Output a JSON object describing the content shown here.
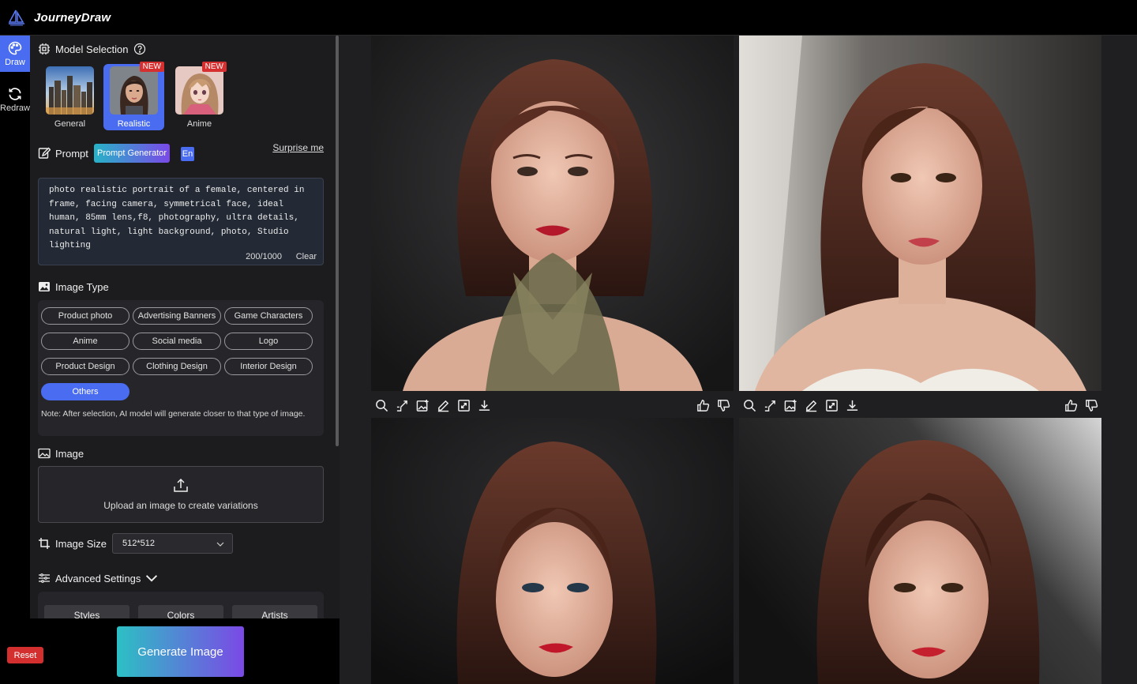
{
  "app": {
    "title": "JourneyDraw"
  },
  "rail": [
    {
      "label": "Draw",
      "icon": "palette-icon",
      "active": true
    },
    {
      "label": "Redraw",
      "icon": "refresh-icon",
      "active": false
    }
  ],
  "model_selection": {
    "title": "Model Selection",
    "models": [
      {
        "label": "General",
        "new": false,
        "active": false
      },
      {
        "label": "Realistic",
        "new": true,
        "badge": "NEW",
        "active": true
      },
      {
        "label": "Anime",
        "new": true,
        "badge": "NEW",
        "active": false
      }
    ]
  },
  "prompt": {
    "title": "Prompt",
    "generator_label": "Prompt Generator",
    "lang_label": "En",
    "surprise_label": "Surprise me",
    "text": "photo realistic portrait of a female, centered in frame, facing camera, symmetrical face, ideal human, 85mm lens,f8, photography, ultra details, natural light, light background, photo, Studio lighting",
    "count": "200/1000",
    "clear_label": "Clear"
  },
  "image_type": {
    "title": "Image Type",
    "options": [
      {
        "label": "Product photo",
        "active": false
      },
      {
        "label": "Advertising Banners",
        "active": false
      },
      {
        "label": "Game Characters",
        "active": false
      },
      {
        "label": "Anime",
        "active": false
      },
      {
        "label": "Social media",
        "active": false
      },
      {
        "label": "Logo",
        "active": false
      },
      {
        "label": "Product Design",
        "active": false
      },
      {
        "label": "Clothing Design",
        "active": false
      },
      {
        "label": "Interior Design",
        "active": false
      },
      {
        "label": "Others",
        "active": true
      }
    ],
    "note": "Note: After selection, AI model will generate closer to that type of image."
  },
  "image": {
    "title": "Image",
    "upload_text": "Upload an image to create variations"
  },
  "image_size": {
    "title": "Image Size",
    "value": "512*512"
  },
  "advanced": {
    "title": "Advanced Settings",
    "tabs": [
      "Styles",
      "Colors",
      "Artists"
    ]
  },
  "actions": {
    "reset_label": "Reset",
    "generate_label": "Generate Image"
  },
  "colors": {
    "accent": "#4a6cf0",
    "danger": "#d32f2f",
    "panel": "#1c1c1e",
    "gallery": "#1f1f21"
  },
  "gallery": {
    "tools": [
      "zoom-icon",
      "upscale-icon",
      "variation-icon",
      "edit-icon",
      "expand-icon",
      "download-icon"
    ],
    "feedback": [
      "thumbs-up-icon",
      "thumbs-down-icon"
    ]
  }
}
